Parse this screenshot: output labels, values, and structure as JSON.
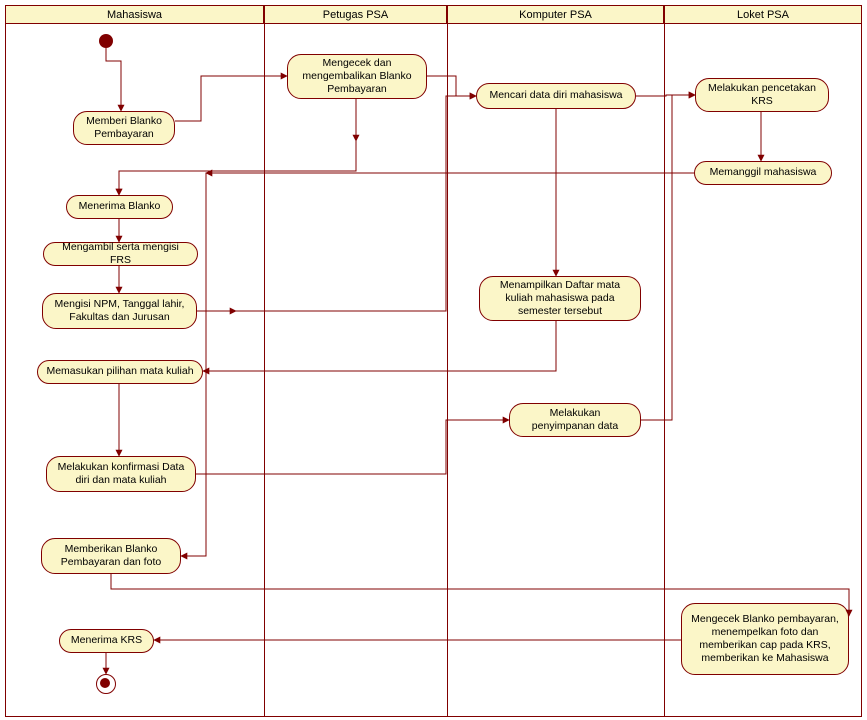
{
  "lanes": {
    "l1": "Mahasiswa",
    "l2": "Petugas PSA",
    "l3": "Komputer PSA",
    "l4": "Loket PSA"
  },
  "activities": {
    "a1": "Memberi Blanko Pembayaran",
    "a2": "Mengecek dan mengembalikan Blanko Pembayaran",
    "a3": "Mencari data diri mahasiswa",
    "a4": "Melakukan pencetakan KRS",
    "a5": "Memanggil mahasiswa",
    "a6": "Menerima Blanko",
    "a7": "Mengambil serta mengisi FRS",
    "a8": "Mengisi NPM, Tanggal lahir, Fakultas dan Jurusan",
    "a9": "Menampilkan Daftar mata kuliah mahasiswa pada semester tersebut",
    "a10": "Memasukan pilihan mata kuliah",
    "a11": "Melakukan penyimpanan data",
    "a12": "Melakukan konfirmasi Data diri dan mata kuliah",
    "a13": "Memberikan Blanko Pembayaran dan foto",
    "a14": "Mengecek Blanko pembayaran, menempelkan foto dan memberikan cap pada KRS, memberikan ke Mahasiswa",
    "a15": "Menerima KRS"
  }
}
